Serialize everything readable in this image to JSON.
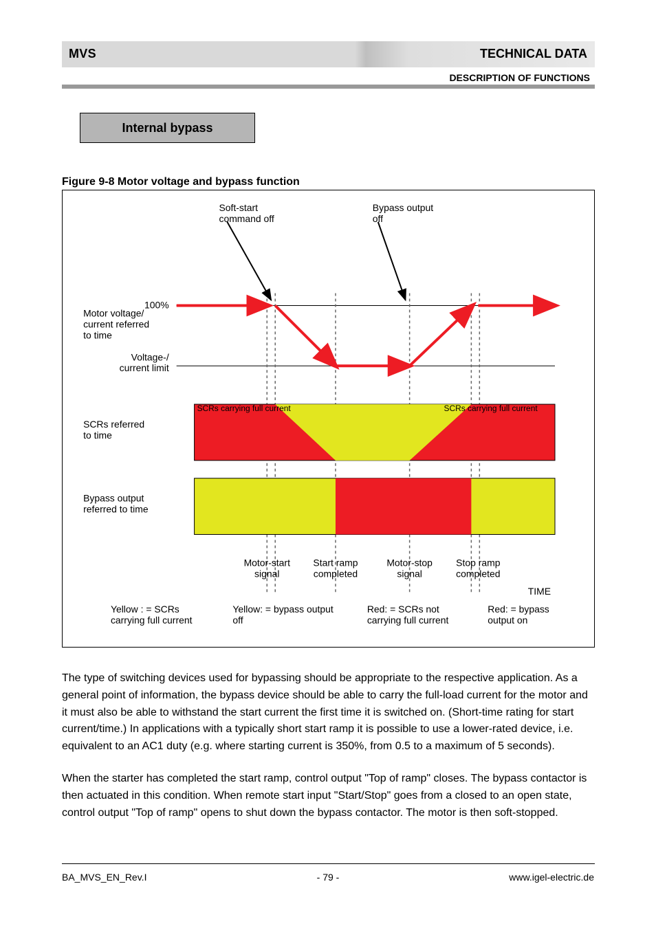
{
  "header": {
    "left": "MVS",
    "right": "TECHNICAL DATA",
    "sub": "DESCRIPTION OF FUNCTIONS"
  },
  "section_chip": "Internal bypass",
  "figure": {
    "number": "Figure 9-8",
    "title": "Motor voltage and bypass function"
  },
  "diagram": {
    "y_top": "100%",
    "y_bottom": "Voltage-/\ncurrent limit",
    "callout1_line1": "Soft-start",
    "callout1_line2": "command off",
    "callout2_line1": "Bypass output",
    "callout2_line2": "off",
    "row1_label_a": "Motor voltage/",
    "row1_label_b": "current referred",
    "row1_label_c": "to time",
    "row2_label_a": "SCRs referred",
    "row2_label_b": "to time",
    "row3_label_a": "Bypass output",
    "row3_label_b": "referred to time",
    "legend1_line1": "Yellow : = SCRs",
    "legend1_line2": "carrying full current",
    "legend2_line1": "Yellow: = bypass output",
    "legend2_line2": "off",
    "legend3_line1": "Red: = SCRs not",
    "legend3_line2": "carrying full current",
    "legend4_line1": "Red: = bypass",
    "legend4_line2": "output on",
    "x_ticks": [
      "Motor-start\nsignal",
      "Start ramp\ncompleted",
      "Motor-stop\nsignal",
      "Stop ramp\ncompleted"
    ],
    "time_label": "TIME"
  },
  "body": {
    "p1": "The type of switching devices used for bypassing should be appropriate to the respective application. As a general point of information, the bypass device should be able to carry the full-load current for the motor and it must also be able to withstand the start current the first time it is switched on. (Short-time rating for start current/time.) In applications with a typically short start ramp it is possible to use a lower-rated device, i.e. equivalent to an AC1 duty (e.g. where starting current is 350%, from 0.5 to a maximum of 5 seconds).",
    "p2": "When the starter has completed the start ramp, control output \"Top of ramp\" closes. The bypass contactor is then actuated in this condition. When remote start input \"Start/Stop\" goes from a closed to an open state, control output \"Top of ramp\" opens to shut down the bypass contactor. The motor is then soft-stopped."
  },
  "footer": {
    "left": "BA_MVS_EN_Rev.I",
    "center": "- 79 -",
    "right": "www.igel-electric.de"
  }
}
